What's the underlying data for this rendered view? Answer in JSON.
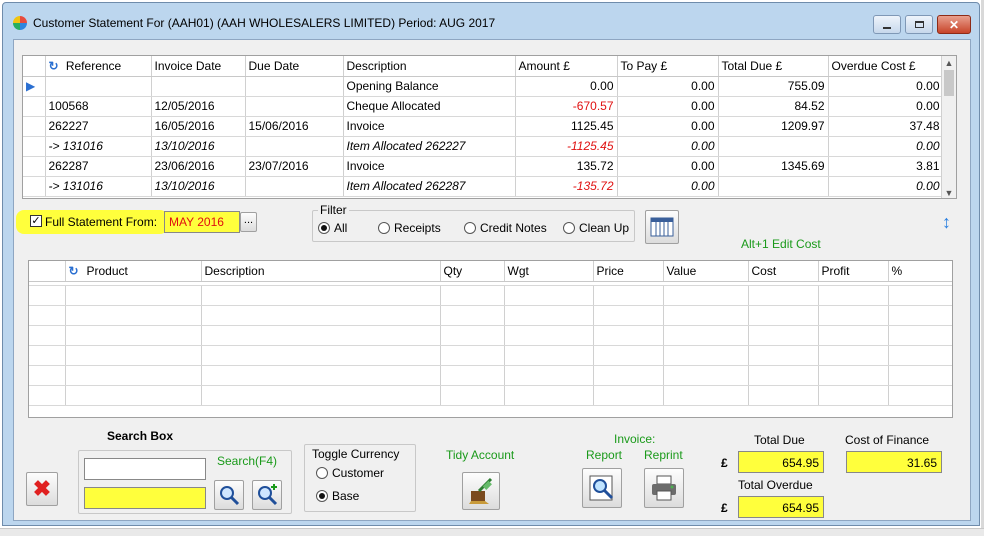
{
  "window": {
    "title": "Customer Statement For (AAH01) (AAH  WHOLESALERS LIMITED) Period: AUG 2017"
  },
  "statement": {
    "headers": [
      "Reference",
      "Invoice Date",
      "Due Date",
      "Description",
      "Amount £",
      "To Pay £",
      "Total Due £",
      "Overdue Cost £"
    ],
    "rows": [
      {
        "ref": "",
        "inv": "",
        "due": "",
        "desc": "Opening Balance",
        "amount": "0.00",
        "topay": "0.00",
        "total": "755.09",
        "overdue": "0.00"
      },
      {
        "ref": "100568",
        "inv": "12/05/2016",
        "due": "",
        "desc": "Cheque Allocated",
        "amount": "-670.57",
        "topay": "0.00",
        "total": "84.52",
        "overdue": "0.00"
      },
      {
        "ref": "262227",
        "inv": "16/05/2016",
        "due": "15/06/2016",
        "desc": "Invoice",
        "amount": "1125.45",
        "topay": "0.00",
        "total": "1209.97",
        "overdue": "37.48"
      },
      {
        "ref": "-> 131016",
        "inv": "13/10/2016",
        "due": "",
        "desc": "Item Allocated 262227",
        "amount": "-1125.45",
        "topay": "0.00",
        "total": "",
        "overdue": "0.00"
      },
      {
        "ref": "262287",
        "inv": "23/06/2016",
        "due": "23/07/2016",
        "desc": "Invoice",
        "amount": "135.72",
        "topay": "0.00",
        "total": "1345.69",
        "overdue": "3.81"
      },
      {
        "ref": "-> 131016",
        "inv": "13/10/2016",
        "due": "",
        "desc": "Item Allocated 262287",
        "amount": "-135.72",
        "topay": "0.00",
        "total": "",
        "overdue": "0.00"
      }
    ]
  },
  "full_statement": {
    "label": "Full Statement From:",
    "value": "MAY 2016",
    "browse": "..."
  },
  "filter": {
    "title": "Filter",
    "options": [
      "All",
      "Receipts",
      "Credit Notes",
      "Clean Up"
    ],
    "selected": "All"
  },
  "edit_cost_hint": "Alt+1 Edit Cost",
  "items": {
    "headers": [
      "Product",
      "Description",
      "Qty",
      "Wgt",
      "Price",
      "Value",
      "Cost",
      "Profit",
      "%"
    ]
  },
  "search": {
    "title": "Search Box",
    "hint": "Search(F4)",
    "value": "",
    "value2": ""
  },
  "currency": {
    "title": "Toggle Currency",
    "options": [
      "Customer",
      "Base"
    ],
    "selected": "Base"
  },
  "tidy_account": "Tidy Account",
  "invoice": {
    "title": "Invoice:",
    "report": "Report",
    "reprint": "Reprint"
  },
  "totals": {
    "currency_symbol": "£",
    "total_due_label": "Total Due",
    "total_due": "654.95",
    "total_overdue_label": "Total Overdue",
    "total_overdue": "654.95",
    "cost_of_finance_label": "Cost of Finance",
    "cost_of_finance": "31.65"
  },
  "colors": {
    "highlight": "#ffff3c",
    "accent_green": "#1a9a1a",
    "negative": "#e01010",
    "frame": "#bcd6ee"
  }
}
